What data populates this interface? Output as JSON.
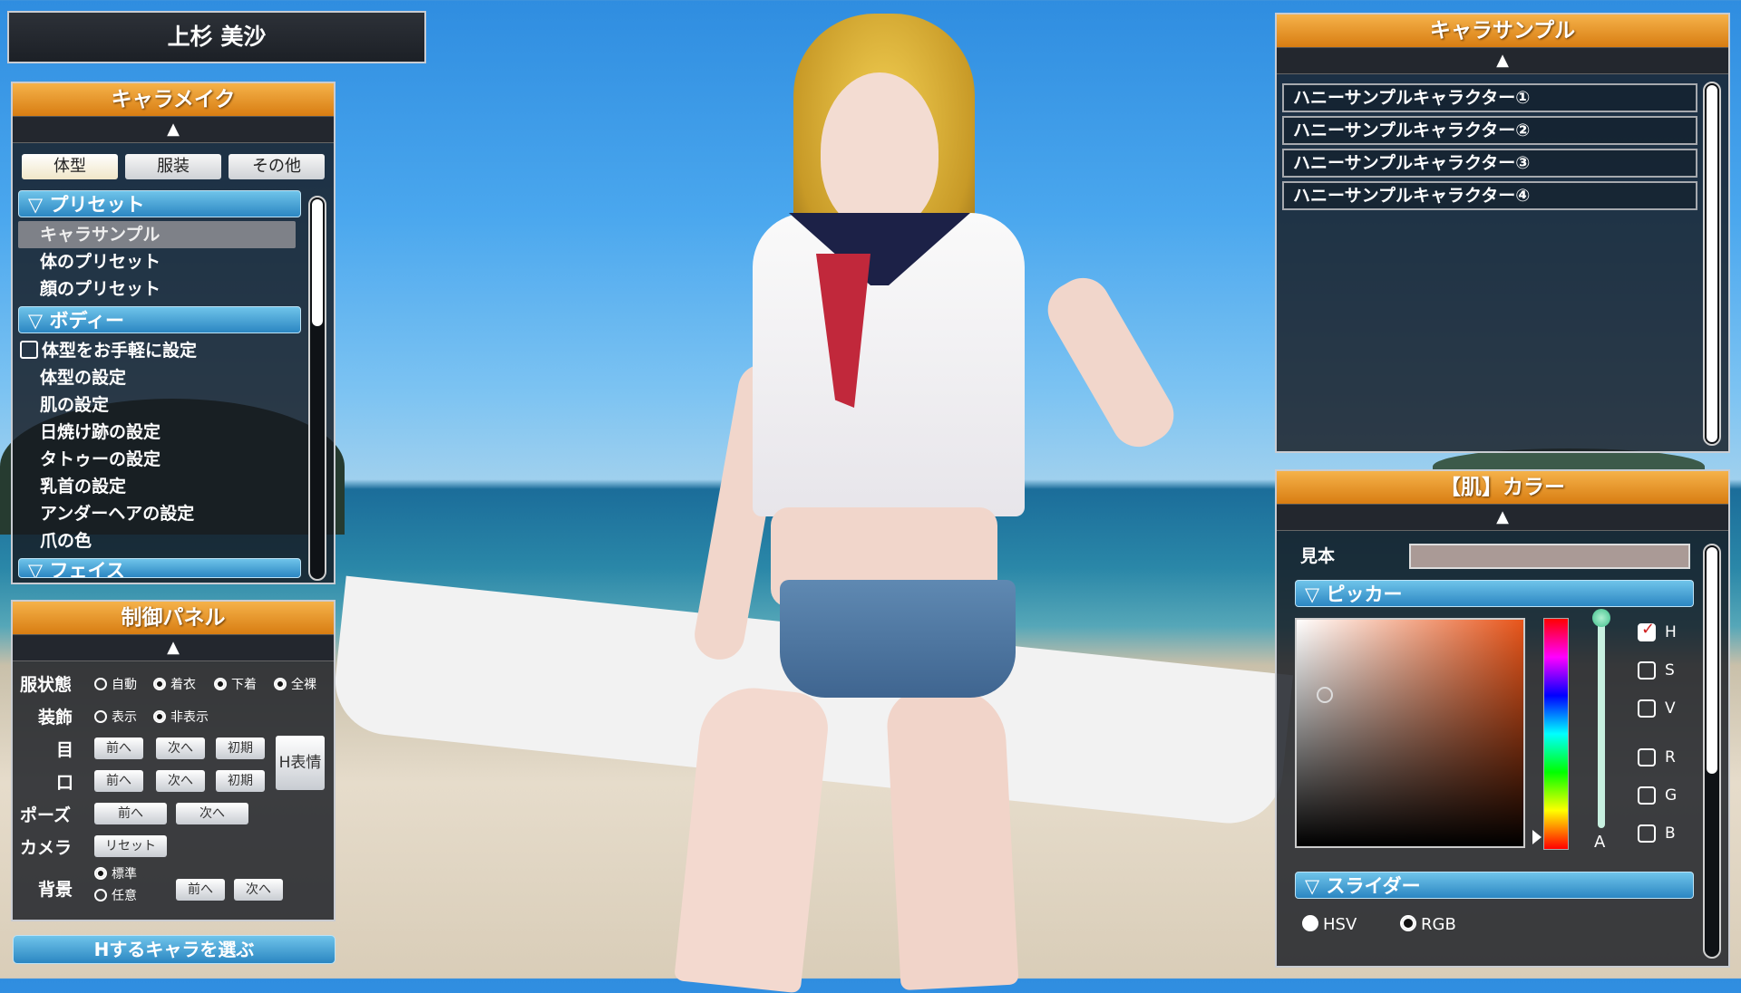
{
  "character_name": "上杉 美沙",
  "left_panel": {
    "title": "キャラメイク",
    "arrow": "▲",
    "tabs": [
      "体型",
      "服装",
      "その他"
    ],
    "sections": [
      {
        "label": "▽ プリセット",
        "items": [
          "キャラサンプル",
          "体のプリセット",
          "顔のプリセット"
        ]
      },
      {
        "label": "▽ ボディー",
        "items": [
          "体型をお手軽に設定",
          "体型の設定",
          "肌の設定",
          "日焼け跡の設定",
          "タトゥーの設定",
          "乳首の設定",
          "アンダーヘアの設定",
          "爪の色"
        ]
      },
      {
        "label": "▽ フェイス",
        "items": []
      }
    ],
    "selected_item": "キャラサンプル"
  },
  "control_panel": {
    "title": "制御パネル",
    "arrow": "▲",
    "clothing_state_label": "服状態",
    "clothing_state_options": [
      "自動",
      "着衣",
      "下着",
      "全裸"
    ],
    "accessory_label": "装飾",
    "accessory_options": [
      "表示",
      "非表示"
    ],
    "eyes_label": "目",
    "mouth_label": "口",
    "prev": "前へ",
    "next": "次へ",
    "initial": "初期",
    "h_expression": "H表情",
    "pose_label": "ポーズ",
    "camera_label": "カメラ",
    "reset": "リセット",
    "background_label": "背景",
    "background_options": [
      "標準",
      "任意"
    ]
  },
  "select_button": "Hするキャラを選ぶ",
  "right_panel": {
    "title": "キャラサンプル",
    "arrow": "▲",
    "samples": [
      "ハニーサンプルキャラクター①",
      "ハニーサンプルキャラクター②",
      "ハニーサンプルキャラクター③",
      "ハニーサンプルキャラクター④"
    ]
  },
  "color_panel": {
    "title": "【肌】カラー",
    "arrow": "▲",
    "sample_label": "見本",
    "sample_color": "#aa9a96",
    "picker_label": "▽ ピッカー",
    "channels": [
      "H",
      "S",
      "V",
      "R",
      "G",
      "B"
    ],
    "checked_channel": "H",
    "alpha_label": "A",
    "slider_label": "▽ スライダー",
    "modes": [
      "HSV",
      "RGB"
    ],
    "hue_color": "#e8551a"
  }
}
